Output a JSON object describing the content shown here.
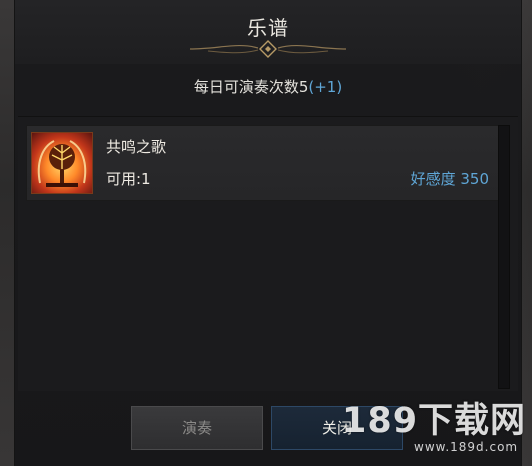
{
  "window": {
    "title": "乐谱"
  },
  "header": {
    "daily_plays_label": "每日可演奏次数5",
    "daily_plays_bonus": "(+1)"
  },
  "song_list": {
    "items": [
      {
        "name": "共鸣之歌",
        "available": "可用:1",
        "affinity": "好感度 350",
        "icon": "golden-tree-icon"
      }
    ]
  },
  "footer": {
    "play_label": "演奏",
    "close_label": "关闭"
  },
  "watermark": {
    "main": "189下载网",
    "sub": "www.189d.com"
  },
  "colors": {
    "accent_blue": "#5fa6d6",
    "panel_bg": "#1b1b1d",
    "close_button_bg": "#1d2a3a"
  }
}
